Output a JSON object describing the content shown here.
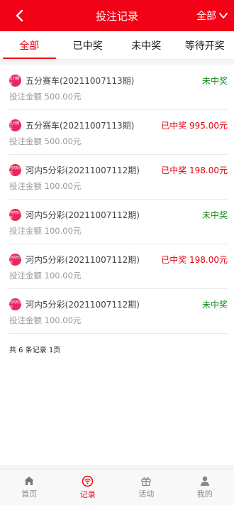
{
  "header": {
    "title": "投注记录",
    "filter_label": "全部"
  },
  "tabs": [
    {
      "label": "全部"
    },
    {
      "label": "已中奖"
    },
    {
      "label": "未中奖"
    },
    {
      "label": "等待开奖"
    }
  ],
  "active_tab": 0,
  "records": [
    {
      "icon_text": "五分赛车",
      "name": "五分赛车(20211007113期)",
      "status": "未中奖",
      "status_type": "lose",
      "amount": "投注金额 500.00元"
    },
    {
      "icon_text": "五分赛车",
      "name": "五分赛车(20211007113期)",
      "status": "已中奖 995.00元",
      "status_type": "win",
      "amount": "投注金额 500.00元"
    },
    {
      "icon_text": "河内5分彩",
      "name": "河内5分彩(20211007112期)",
      "status": "已中奖 198.00元",
      "status_type": "win",
      "amount": "投注金额 100.00元"
    },
    {
      "icon_text": "河内5分彩",
      "name": "河内5分彩(20211007112期)",
      "status": "未中奖",
      "status_type": "lose",
      "amount": "投注金额 100.00元"
    },
    {
      "icon_text": "河内5分彩",
      "name": "河内5分彩(20211007112期)",
      "status": "已中奖 198.00元",
      "status_type": "win",
      "amount": "投注金额 100.00元"
    },
    {
      "icon_text": "河内5分彩",
      "name": "河内5分彩(20211007112期)",
      "status": "未中奖",
      "status_type": "lose",
      "amount": "投注金额 100.00元"
    }
  ],
  "summary": "共 6 条记录 1页",
  "bottom_nav": [
    {
      "label": "首页",
      "icon": "home-icon"
    },
    {
      "label": "记录",
      "icon": "record-icon"
    },
    {
      "label": "活动",
      "icon": "gift-icon"
    },
    {
      "label": "我的",
      "icon": "user-icon"
    }
  ],
  "active_nav": 1,
  "colors": {
    "brand": "#f10216",
    "win": "#e00010",
    "lose": "#138a1c",
    "icon_bg": "#e9285e"
  }
}
